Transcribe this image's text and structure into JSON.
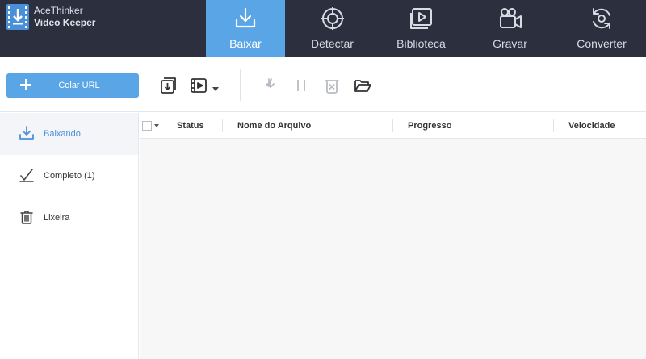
{
  "brand": {
    "line1": "AceThinker",
    "line2": "Video Keeper"
  },
  "nav": {
    "tabs": [
      {
        "label": "Baixar",
        "icon": "download-tray-icon",
        "active": true
      },
      {
        "label": "Detectar",
        "icon": "target-icon",
        "active": false
      },
      {
        "label": "Biblioteca",
        "icon": "video-library-icon",
        "active": false
      },
      {
        "label": "Gravar",
        "icon": "video-camera-icon",
        "active": false
      },
      {
        "label": "Converter",
        "icon": "convert-refresh-icon",
        "active": false
      }
    ]
  },
  "toolbar": {
    "paste_url_label": "Colar URL",
    "icons": [
      "download-queue-icon",
      "video-format-icon",
      "dropdown-caret-icon",
      "resume-download-icon",
      "pause-icon",
      "delete-icon",
      "open-folder-icon"
    ]
  },
  "sidebar": {
    "items": [
      {
        "label": "Baixando",
        "icon": "download-icon",
        "active": true
      },
      {
        "label": "Completo (1)",
        "icon": "checkmark-icon",
        "active": false
      },
      {
        "label": "Lixeira",
        "icon": "trash-icon",
        "active": false
      }
    ]
  },
  "table": {
    "columns": [
      "Status",
      "Nome do Arquivo",
      "Progresso",
      "Velocidade"
    ],
    "rows": []
  },
  "colors": {
    "topbar": "#2b2f3e",
    "accent": "#5aa5e6",
    "sidebar_active_text": "#4a90d9",
    "table_bg": "#f7f7f7"
  }
}
